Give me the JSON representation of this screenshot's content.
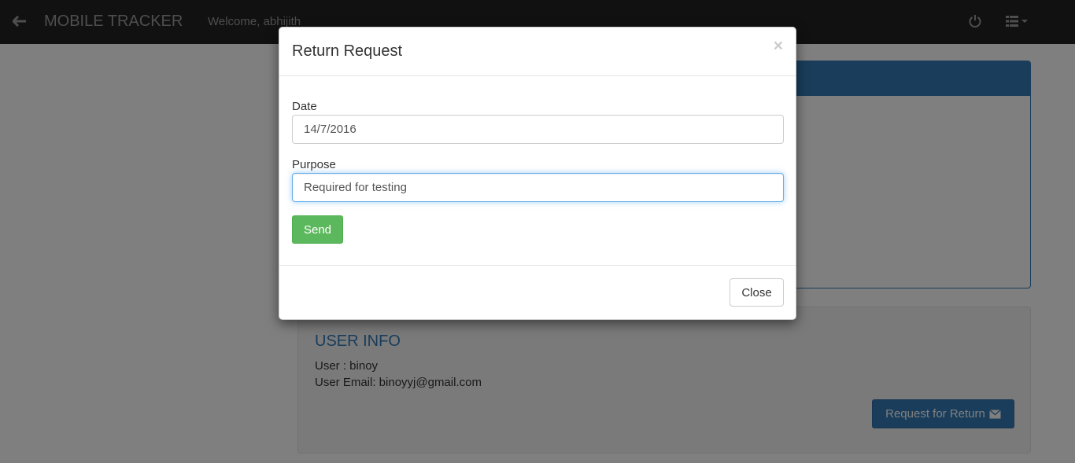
{
  "navbar": {
    "brand": "MOBILE TRACKER",
    "welcome": "Welcome, abhijith",
    "back_icon": "arrow-left-icon",
    "power_icon": "power-icon",
    "menu_icon": "list-icon"
  },
  "user_info": {
    "title": "USER INFO",
    "user_line": "User : binoy",
    "email_line": "User Email: binoyyj@gmail.com",
    "request_button": "Request for Return",
    "request_icon": "envelope-icon"
  },
  "modal": {
    "title": "Return Request",
    "close_symbol": "×",
    "date_label": "Date",
    "date_value": "14/7/2016",
    "purpose_label": "Purpose",
    "purpose_value": "Required for testing",
    "send_label": "Send",
    "close_label": "Close"
  },
  "colors": {
    "navbar": "#222222",
    "primary": "#337ab7",
    "success": "#5cb85c"
  }
}
